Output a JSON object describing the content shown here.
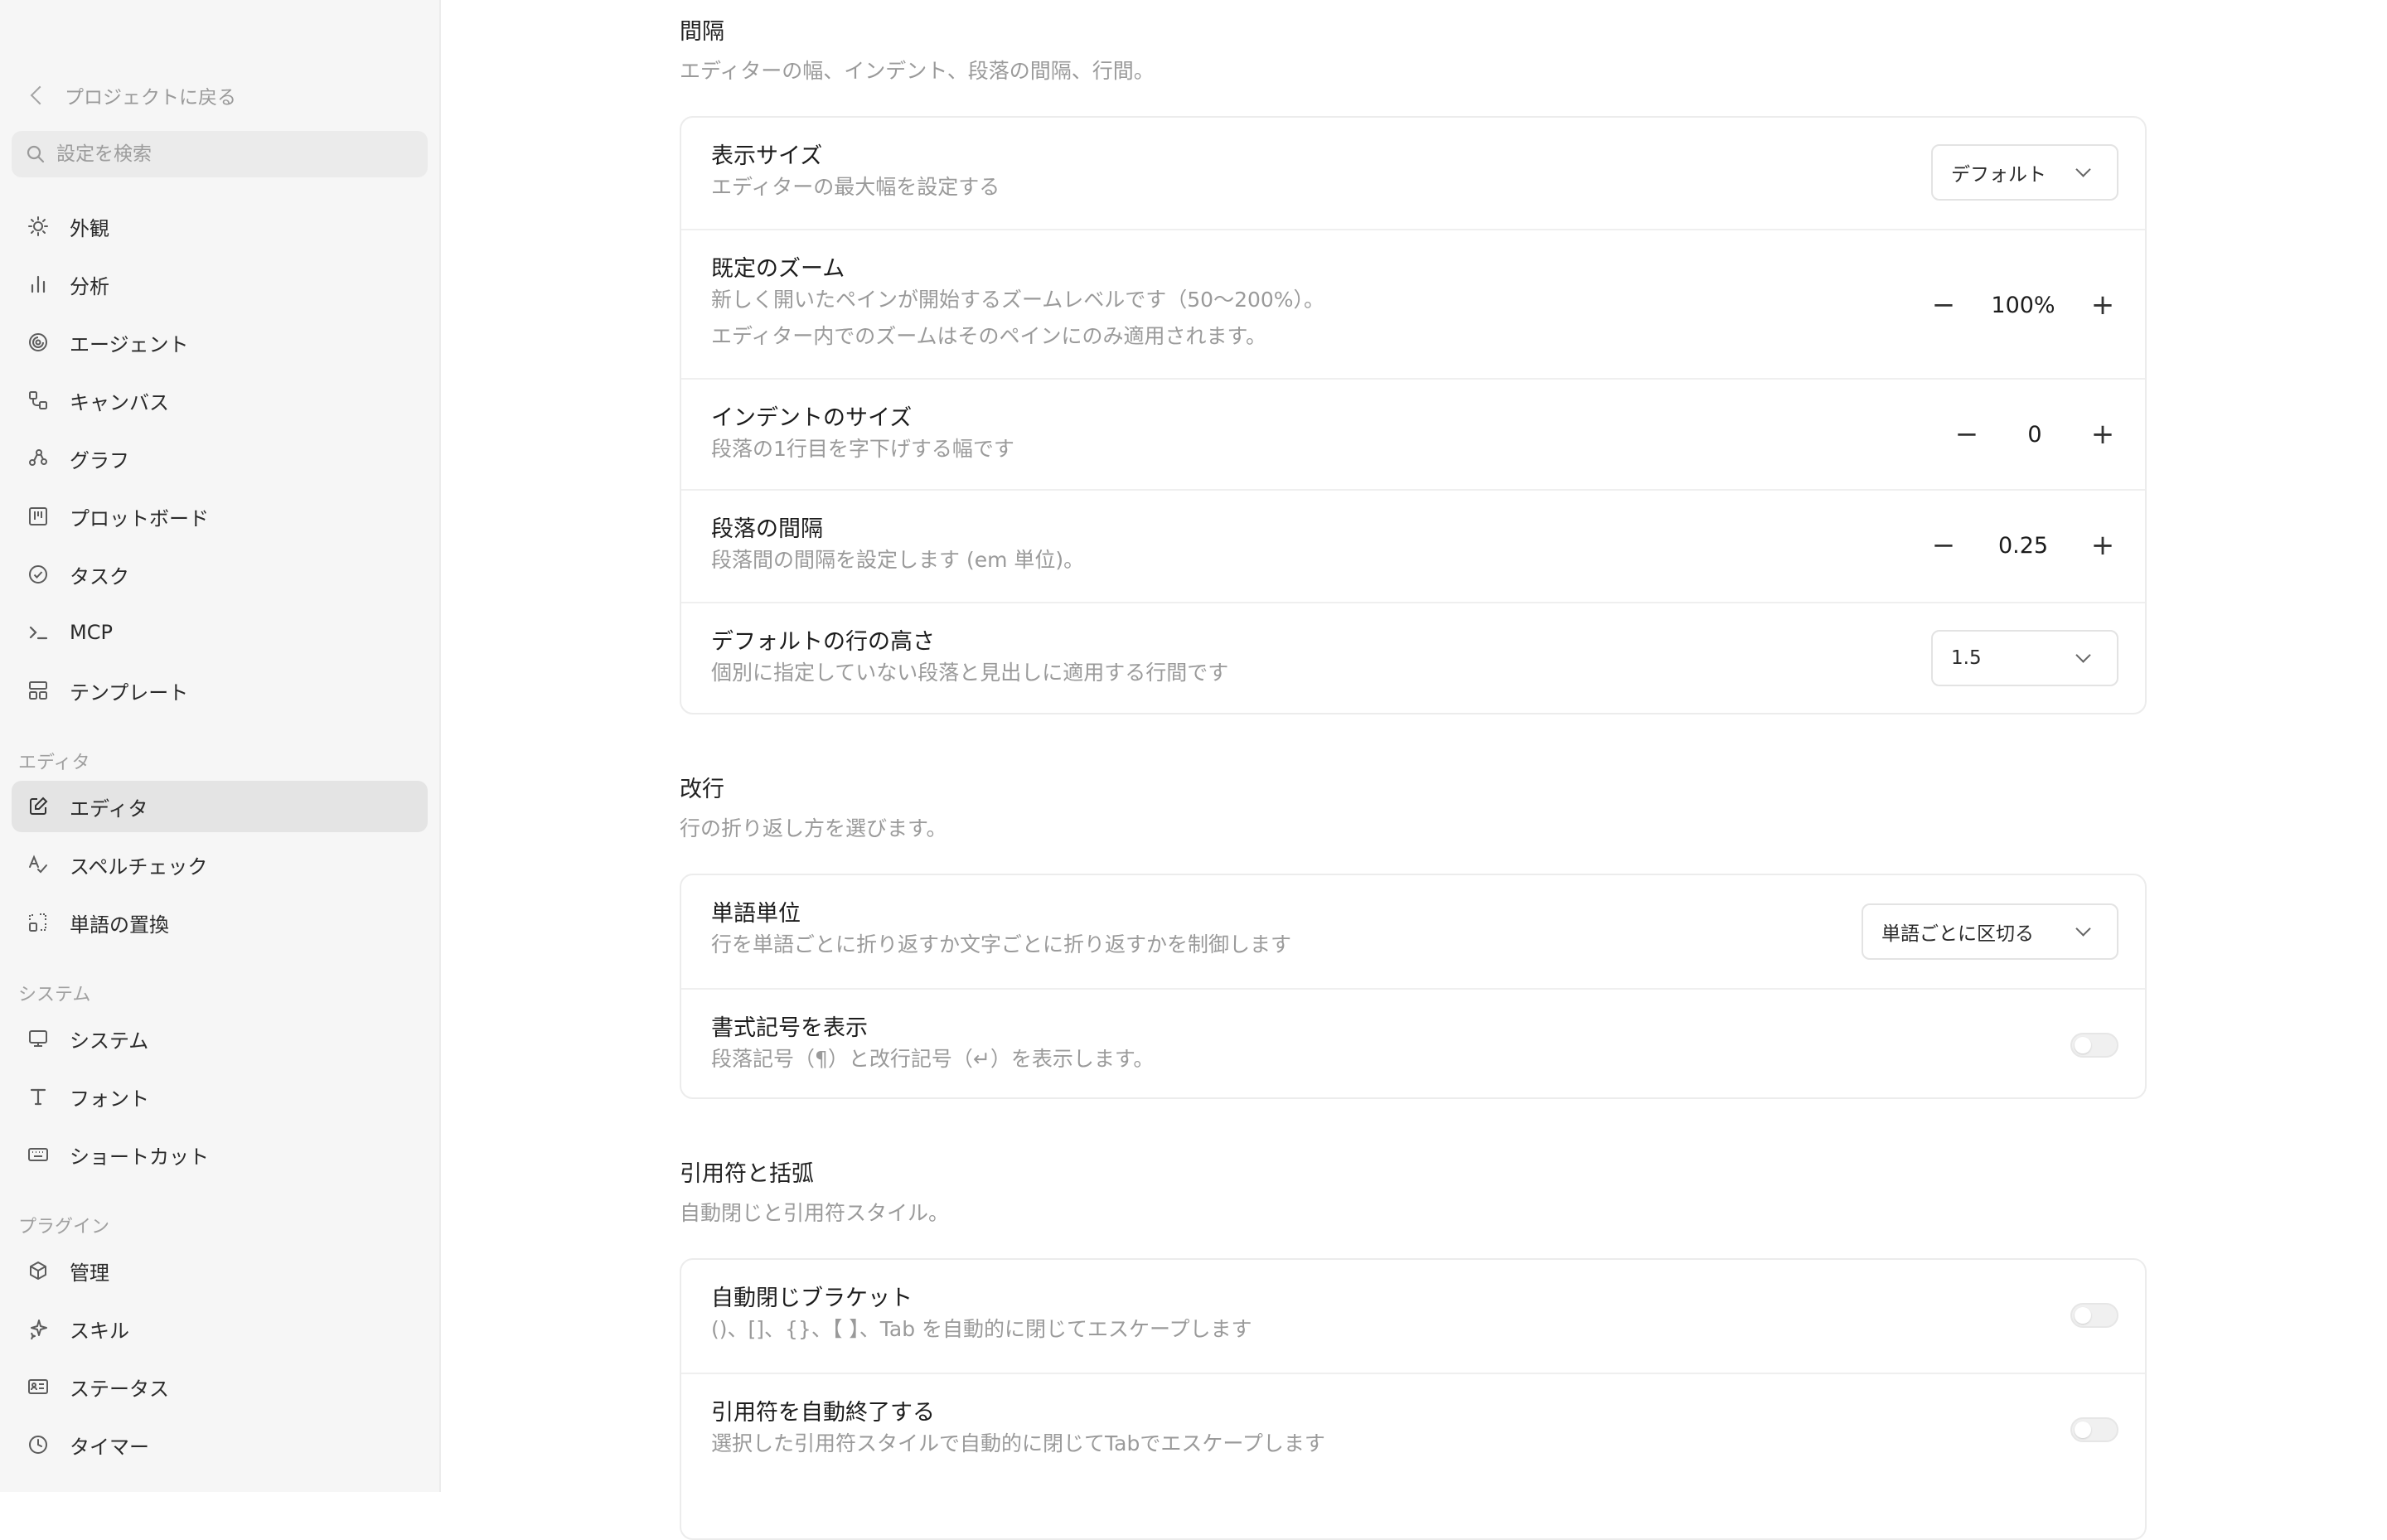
{
  "sidebar": {
    "back_label": "プロジェクトに戻る",
    "search_placeholder": "設定を検索",
    "items": [
      {
        "label": "外観",
        "icon": "sun-icon"
      },
      {
        "label": "分析",
        "icon": "bar-chart-icon"
      },
      {
        "label": "エージェント",
        "icon": "spiral-icon"
      },
      {
        "label": "キャンバス",
        "icon": "canvas-icon"
      },
      {
        "label": "グラフ",
        "icon": "graph-icon"
      },
      {
        "label": "プロットボード",
        "icon": "board-icon"
      },
      {
        "label": "タスク",
        "icon": "check-circle-icon"
      },
      {
        "label": "MCP",
        "icon": "terminal-icon"
      },
      {
        "label": "テンプレート",
        "icon": "template-icon"
      }
    ],
    "section_editor": "エディタ",
    "editor_items": [
      {
        "label": "エディタ",
        "icon": "edit-icon",
        "active": true
      },
      {
        "label": "スペルチェック",
        "icon": "spellcheck-icon"
      },
      {
        "label": "単語の置換",
        "icon": "replace-icon"
      }
    ],
    "section_system": "システム",
    "system_items": [
      {
        "label": "システム",
        "icon": "monitor-icon"
      },
      {
        "label": "フォント",
        "icon": "font-icon"
      },
      {
        "label": "ショートカット",
        "icon": "keyboard-icon"
      }
    ],
    "section_plugins": "プラグイン",
    "plugin_items": [
      {
        "label": "管理",
        "icon": "package-icon"
      },
      {
        "label": "スキル",
        "icon": "sparkle-icon"
      },
      {
        "label": "ステータス",
        "icon": "id-card-icon"
      },
      {
        "label": "タイマー",
        "icon": "clock-icon"
      }
    ]
  },
  "spacing": {
    "title": "間隔",
    "description": "エディターの幅、インデント、段落の間隔、行間。",
    "display_size": {
      "title": "表示サイズ",
      "description": "エディターの最大幅を設定する",
      "value": "デフォルト"
    },
    "default_zoom": {
      "title": "既定のズーム",
      "description1": "新しく開いたペインが開始するズームレベルです（50〜200%）。",
      "description2": "エディター内でのズームはそのペインにのみ適用されます。",
      "value": "100%"
    },
    "indent_size": {
      "title": "インデントのサイズ",
      "description": "段落の1行目を字下げする幅です",
      "value": "0"
    },
    "paragraph_spacing": {
      "title": "段落の間隔",
      "description": "段落間の間隔を設定します (em 単位)。",
      "value": "0.25"
    },
    "line_height": {
      "title": "デフォルトの行の高さ",
      "description": "個別に指定していない段落と見出しに適用する行間です",
      "value": "1.5"
    }
  },
  "line_break": {
    "title": "改行",
    "description": "行の折り返し方を選びます。",
    "word_unit": {
      "title": "単語単位",
      "description": "行を単語ごとに折り返すか文字ごとに折り返すかを制御します",
      "value": "単語ごとに区切る"
    },
    "show_marks": {
      "title": "書式記号を表示",
      "description": "段落記号（¶）と改行記号（↵）を表示します。",
      "enabled": false
    }
  },
  "quotes": {
    "title": "引用符と括弧",
    "description": "自動閉じと引用符スタイル。",
    "auto_bracket": {
      "title": "自動閉じブラケット",
      "description": "()、[]、{}、【 】、Tab を自動的に閉じてエスケープします",
      "enabled": false
    },
    "auto_quote": {
      "title": "引用符を自動終了する",
      "description": "選択した引用符スタイルで自動的に閉じてTabでエスケープします",
      "enabled": false
    }
  },
  "icons": {
    "minus": "−",
    "plus": "+"
  }
}
